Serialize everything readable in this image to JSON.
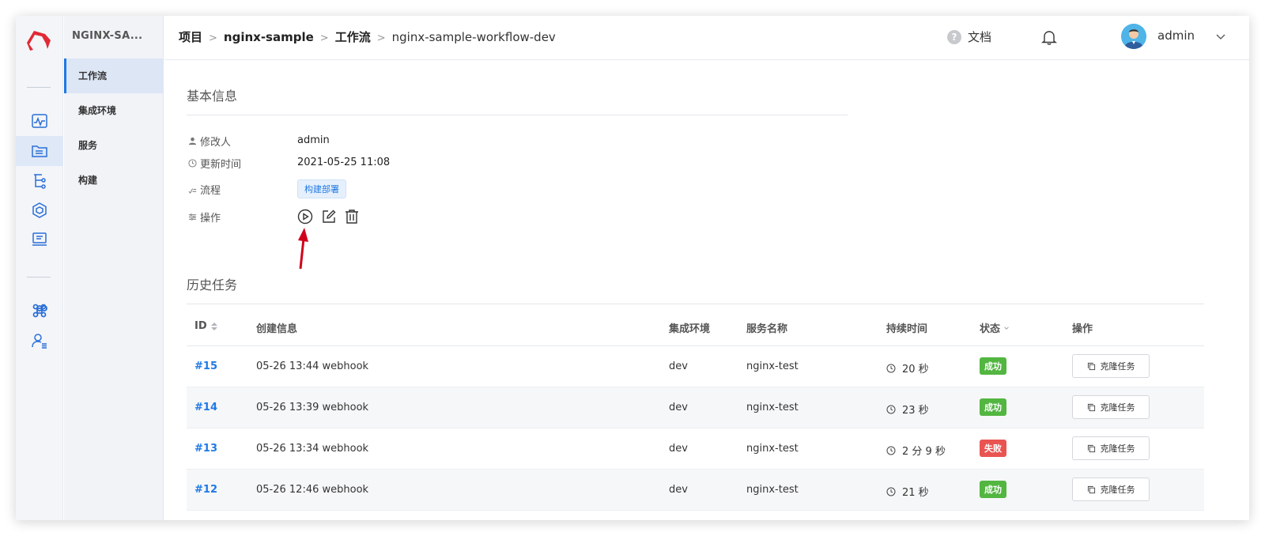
{
  "brand": {
    "project": "NGINX-SA..."
  },
  "subnav": {
    "items": [
      {
        "label": "工作流",
        "active": true
      },
      {
        "label": "集成环境",
        "active": false
      },
      {
        "label": "服务",
        "active": false
      },
      {
        "label": "构建",
        "active": false
      }
    ]
  },
  "header": {
    "breadcrumb": [
      "项目",
      "nginx-sample",
      "工作流",
      "nginx-sample-workflow-dev"
    ],
    "separator": ">",
    "help_glyph": "?",
    "docs_label": "文档",
    "username": "admin"
  },
  "basic_info": {
    "title": "基本信息",
    "modifier_label": "修改人",
    "modifier": "admin",
    "updated_label": "更新时间",
    "updated": "2021-05-25 11:08",
    "flow_label": "流程",
    "flow_tag": "构建部署",
    "actions_label": "操作"
  },
  "history": {
    "title": "历史任务",
    "columns": {
      "id": "ID",
      "created": "创建信息",
      "env": "集成环境",
      "service": "服务名称",
      "duration": "持续时间",
      "status": "状态",
      "actions": "操作"
    },
    "clone_label": "克隆任务",
    "rows": [
      {
        "id": "#15",
        "created": "05-26 13:44 webhook",
        "env": "dev",
        "service": "nginx-test",
        "duration": "20 秒",
        "status": "成功",
        "ok": true
      },
      {
        "id": "#14",
        "created": "05-26 13:39 webhook",
        "env": "dev",
        "service": "nginx-test",
        "duration": "23 秒",
        "status": "成功",
        "ok": true
      },
      {
        "id": "#13",
        "created": "05-26 13:34 webhook",
        "env": "dev",
        "service": "nginx-test",
        "duration": "2 分 9 秒",
        "status": "失败",
        "ok": false
      },
      {
        "id": "#12",
        "created": "05-26 12:46 webhook",
        "env": "dev",
        "service": "nginx-test",
        "duration": "21 秒",
        "status": "成功",
        "ok": true
      }
    ]
  },
  "colors": {
    "accent": "#1f79e5",
    "success": "#52b641",
    "fail": "#e95451",
    "logo": "#e02a35",
    "arrow": "#d0021b"
  }
}
